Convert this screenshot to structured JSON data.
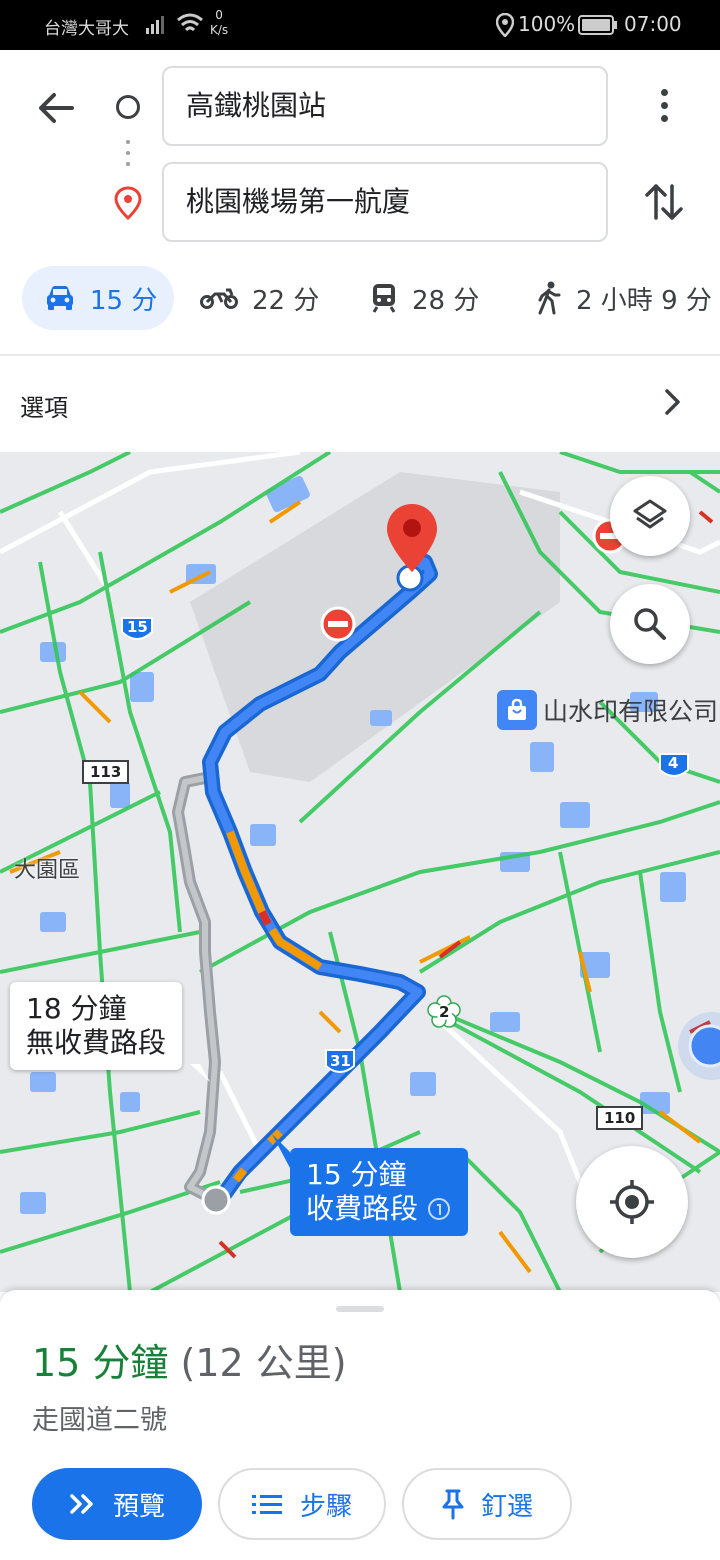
{
  "status_bar": {
    "carrier": "台灣大哥大",
    "net_speed_value": "0",
    "net_speed_unit": "K/s",
    "battery": "100%",
    "time": "07:00"
  },
  "directions": {
    "origin": "高鐵桃園站",
    "destination": "桃園機場第一航廈"
  },
  "modes": [
    {
      "name": "car",
      "time": "15 分",
      "active": true
    },
    {
      "name": "motorcycle",
      "time": "22 分"
    },
    {
      "name": "transit",
      "time": "28 分"
    },
    {
      "name": "walk",
      "time": "2 小時 9 分"
    }
  ],
  "options_label": "選項",
  "map": {
    "alt_route": {
      "line1": "18 分鐘",
      "line2": "無收費路段"
    },
    "main_route": {
      "line1": "15 分鐘",
      "line2": "收費路段"
    },
    "place": "山水印有限公司",
    "area": "大園區",
    "shields": {
      "r15": "15",
      "r113": "113",
      "r4": "4",
      "r31": "31",
      "r2": "2",
      "r110": "110"
    }
  },
  "summary": {
    "duration": "15 分鐘",
    "distance": "(12 公里)",
    "via": "走國道二號"
  },
  "buttons": {
    "preview": "預覽",
    "steps": "步驟",
    "pin": "釘選"
  },
  "colors": {
    "accent": "#1a73e8",
    "duration_green": "#188038",
    "traffic_green": "#34c759",
    "traffic_orange": "#f29900",
    "traffic_red": "#d93025",
    "destination_pin": "#ea4335"
  }
}
